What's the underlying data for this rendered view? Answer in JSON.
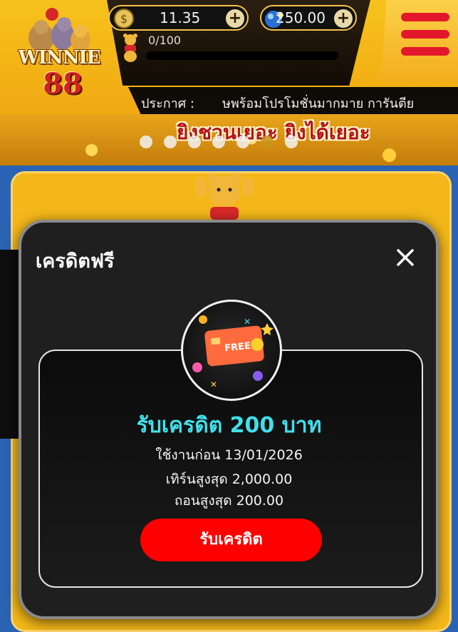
{
  "header": {
    "logo_word": "WINNIE",
    "logo_number": "88",
    "coin_balance": "11.35",
    "gem_balance": "250.00",
    "plus_symbol": "+",
    "level_progress_text": "0/100",
    "level_progress_fraction": 0.0
  },
  "announcement": {
    "label": "ประกาศ :",
    "text": "ษพร้อมโปรโมชั่นมากมาย การันตีย"
  },
  "banner": {
    "text": "ยิงชวนเยอะ ยิงได้เยอะ",
    "slide_count": 7
  },
  "modal": {
    "title": "เครดิตฟรี",
    "close_symbol": "✕",
    "card_icon_text": "FREE",
    "headline": "รับเครดิต 200 บาท",
    "expiry": "ใช้งานก่อน 13/01/2026",
    "max_turnover": "เทิร์นสูงสุด 2,000.00",
    "max_withdraw": "ถอนสูงสุด 200.00",
    "claim_button": "รับเครดิต"
  },
  "colors": {
    "accent_yellow": "#f5c44a",
    "headline_cyan": "#3fe0ea",
    "claim_red": "#ff0000",
    "menu_red": "#e3172b"
  }
}
